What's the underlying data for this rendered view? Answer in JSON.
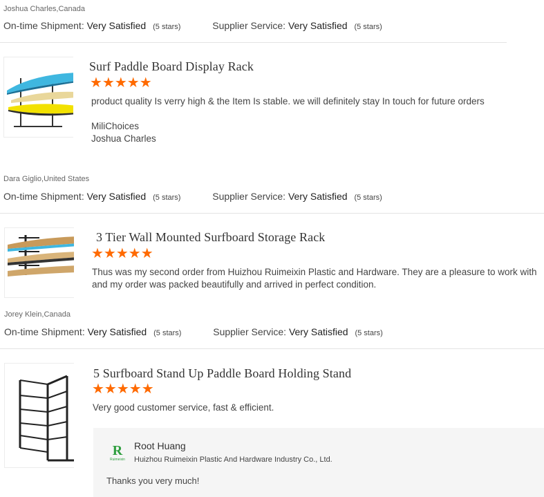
{
  "reviews": [
    {
      "reviewer": "Joshua Charles,Canada",
      "shipment_label": "On-time Shipment:",
      "shipment_value": "Very Satisfied",
      "shipment_stars": "(5 stars)",
      "supplier_label": "Supplier Service:",
      "supplier_value": "Very Satisfied",
      "supplier_stars": "(5 stars)"
    },
    {
      "product_title": "Surf Paddle Board Display Rack",
      "stars": "★★★★★",
      "comment": "product quality Is verry high & the Item Is stable. we will definitely stay In touch for future orders",
      "sig_line1": "MiliChoices",
      "sig_line2": "Joshua Charles",
      "reviewer": "Dara Giglio,United States",
      "shipment_label": "On-time Shipment:",
      "shipment_value": "Very Satisfied",
      "shipment_stars": "(5 stars)",
      "supplier_label": "Supplier Service:",
      "supplier_value": "Very Satisfied",
      "supplier_stars": "(5 stars)"
    },
    {
      "product_title": "3 Tier Wall Mounted Surfboard Storage Rack",
      "stars": "★★★★★",
      "comment": "Thus was my second order from Huizhou Ruimeixin Plastic and Hardware. They are a pleasure to work with and my order was packed beautifully and arrived in perfect condition.",
      "reviewer": "Jorey Klein,Canada",
      "shipment_label": "On-time Shipment:",
      "shipment_value": "Very Satisfied",
      "shipment_stars": "(5 stars)",
      "supplier_label": "Supplier Service:",
      "supplier_value": "Very Satisfied",
      "supplier_stars": "(5 stars)"
    },
    {
      "product_title": "5 Surfboard Stand Up Paddle Board Holding Stand",
      "stars": "★★★★★",
      "comment": "Very good customer service, fast & efficient.",
      "reply": {
        "logo_text": "R",
        "logo_subtext": "Ruimeixin",
        "name": "Root Huang",
        "company": "Huizhou Ruimeixin Plastic And Hardware Industry Co., Ltd.",
        "text": "Thanks  you very much!"
      }
    }
  ],
  "colors": {
    "star": "#ff6a00",
    "logo_green": "#2e9e3e"
  }
}
